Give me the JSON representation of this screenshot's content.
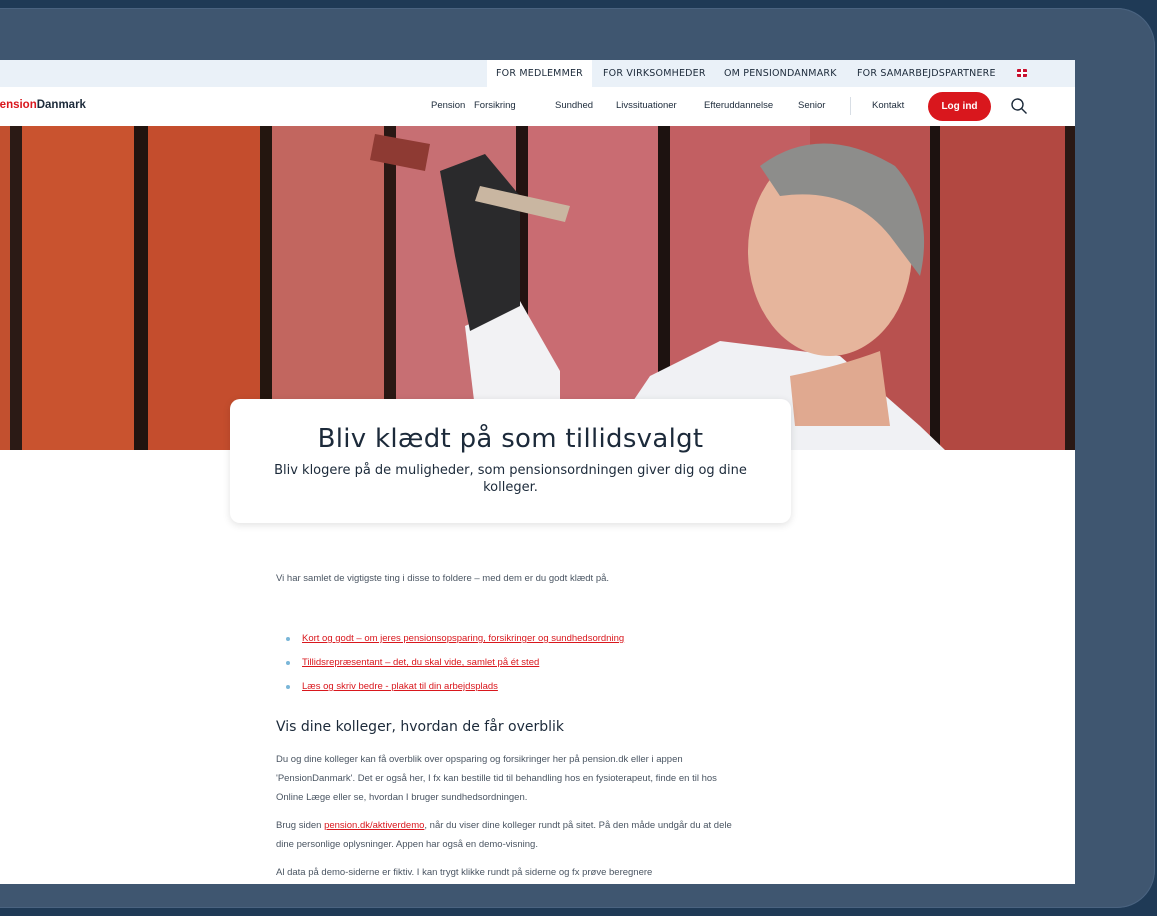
{
  "utility_nav": {
    "items": [
      "FOR MEDLEMMER",
      "FOR VIRKSOMHEDER",
      "OM PENSIONDANMARK",
      "FOR SAMARBEJDSPARTNERE"
    ],
    "language_icon": "uk-flag-icon"
  },
  "main_nav": {
    "logo_part1": "Pension",
    "logo_part2": "Danmark",
    "links": [
      "Pension",
      "Forsikring",
      "Sundhed",
      "Livssituationer",
      "Efteruddannelse",
      "Senior"
    ],
    "contact": "Kontakt",
    "login_label": "Log ind",
    "search_icon": "search-icon"
  },
  "hero": {
    "title": "Bliv klædt på som tillidsvalgt",
    "subtitle": "Bliv klogere på de muligheder, som pensionsordningen giver dig og dine kolleger."
  },
  "content": {
    "intro": "Vi har samlet de vigtigste ting i disse to foldere – med dem er du godt klædt på.",
    "links": [
      "Kort og godt – om jeres pensionsopsparing, forsikringer og sundhedsordning",
      "Tillidsrepræsentant – det, du skal vide, samlet på ét sted",
      "Læs og skriv bedre - plakat til din arbejdsplads"
    ],
    "heading": "Vis dine kolleger, hvordan de får overblik",
    "para1": "Du og dine kolleger kan få overblik over opsparing og forsikringer her på pension.dk eller i appen 'PensionDanmark'. Det er også her, I fx kan bestille tid til behandling hos en fysioterapeut, finde en til hos Online Læge eller se, hvordan I bruger sundhedsordningen.",
    "para2_pre": "Brug siden ",
    "para2_link": "pension.dk/aktiverdemo",
    "para2_post": ", når du viser dine kolleger rundt på sitet. På den måde undgår du at dele dine personlige oplysninger. Appen har også en demo-visning.",
    "para3": "Al data på demo-siderne er fiktiv. I kan trygt klikke rundt på siderne og fx prøve beregnere"
  },
  "colors": {
    "brand_red": "#d9171d",
    "navy_text": "#1c2a3a",
    "utility_bg": "#eaf1f8"
  }
}
